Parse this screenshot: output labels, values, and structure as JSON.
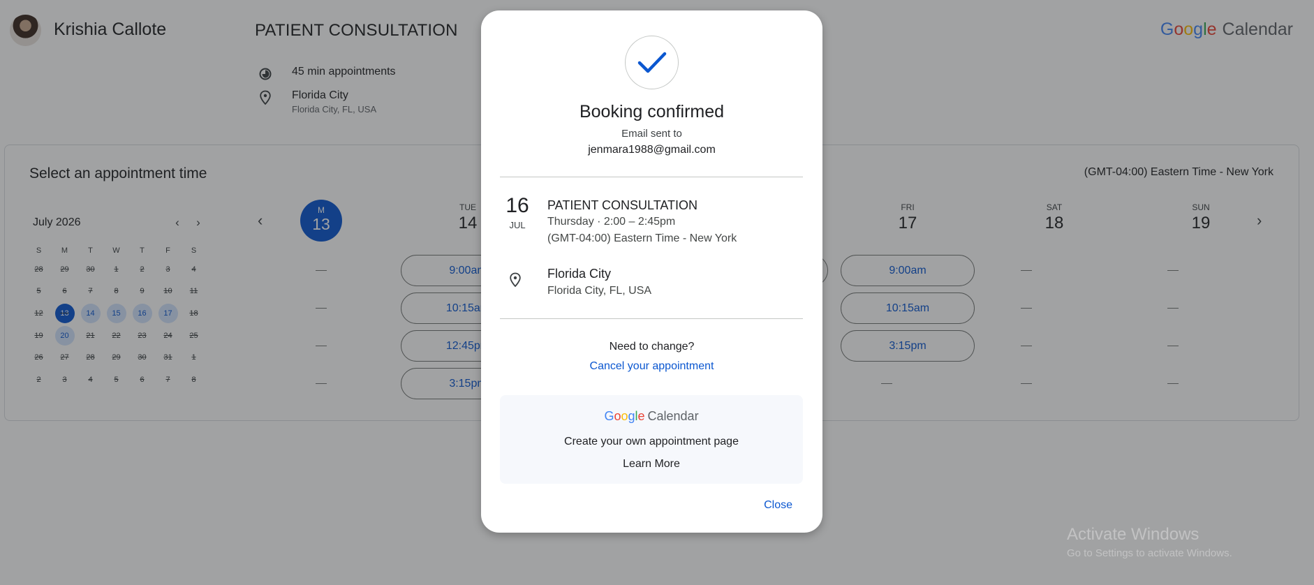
{
  "header": {
    "host_name": "Krishia Callote",
    "event_title": "PATIENT CONSULTATION",
    "duration": "45 min appointments",
    "location_name": "Florida City",
    "location_address": "Florida City, FL, USA",
    "brand_g": [
      "G",
      "o",
      "o",
      "g",
      "l",
      "e"
    ],
    "brand_calendar": "Calendar"
  },
  "schedule": {
    "title": "Select an appointment time",
    "timezone": "(GMT-04:00) Eastern Time - New York",
    "mini_calendar": {
      "month": "July 2026",
      "weekdays": [
        "S",
        "M",
        "T",
        "W",
        "T",
        "F",
        "S"
      ],
      "days": [
        [
          "28",
          "29",
          "30",
          "1",
          "2",
          "3",
          "4"
        ],
        [
          "5",
          "6",
          "7",
          "8",
          "9",
          "10",
          "11"
        ],
        [
          "12",
          "13",
          "14",
          "15",
          "16",
          "17",
          "18"
        ],
        [
          "19",
          "20",
          "21",
          "22",
          "23",
          "24",
          "25"
        ],
        [
          "26",
          "27",
          "28",
          "29",
          "30",
          "31",
          "1"
        ],
        [
          "2",
          "3",
          "4",
          "5",
          "6",
          "7",
          "8"
        ]
      ],
      "selected": "13",
      "available": [
        "14",
        "15",
        "16",
        "17",
        "20"
      ]
    },
    "days": [
      {
        "dow": "M",
        "num": "13",
        "selected": true
      },
      {
        "dow": "TUE",
        "num": "14"
      },
      {
        "dow": "FRI",
        "num": "17"
      },
      {
        "dow": "SAT",
        "num": "18"
      },
      {
        "dow": "SUN",
        "num": "19"
      }
    ],
    "tue_slots": [
      "9:00am",
      "10:15am",
      "12:45pm",
      "3:15pm"
    ],
    "fri_slots": [
      "9:00am",
      "10:15am",
      "3:15pm"
    ]
  },
  "dialog": {
    "title": "Booking confirmed",
    "email_label": "Email sent to",
    "email": "jenmara1988@gmail.com",
    "date_day": "16",
    "date_month": "JUL",
    "event_name": "PATIENT CONSULTATION",
    "event_when": "Thursday · 2:00 – 2:45pm",
    "event_tz": "(GMT-04:00) Eastern Time - New York",
    "location_name": "Florida City",
    "location_address": "Florida City, FL, USA",
    "need_change": "Need to change?",
    "cancel_label": "Cancel your appointment",
    "promo_calendar": "Calendar",
    "promo_text": "Create your own appointment page",
    "promo_link": "Learn More",
    "close_label": "Close"
  },
  "watermark": {
    "title": "Activate Windows",
    "subtitle": "Go to Settings to activate Windows."
  },
  "colors": {
    "accent": "#0b57d0",
    "available_bg": "#d3e3fd",
    "overlay": "rgba(32,33,36,0.42)"
  }
}
